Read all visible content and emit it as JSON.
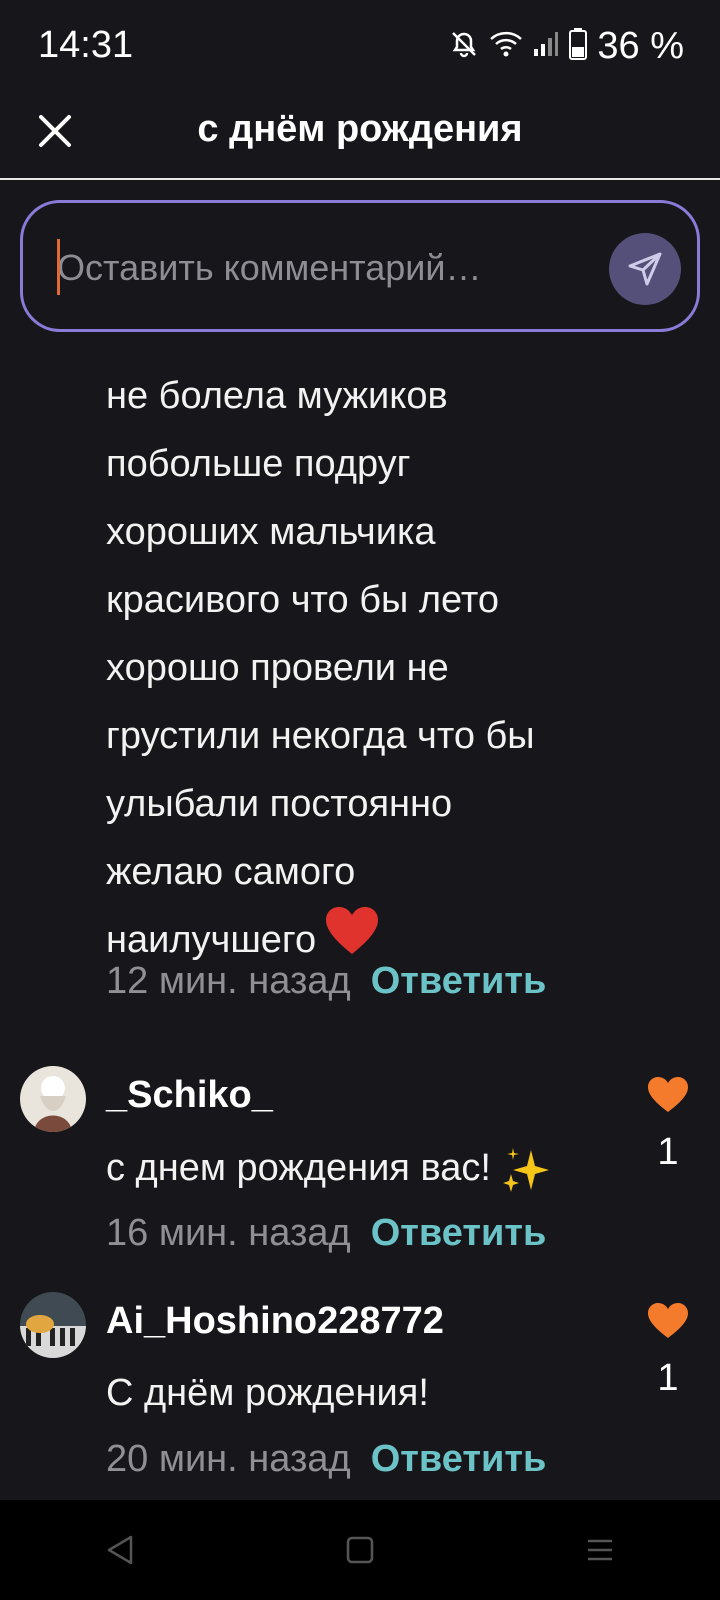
{
  "status": {
    "time": "14:31",
    "battery_text": "36 %",
    "icons": [
      "mute-icon",
      "wifi-icon",
      "signal-icon",
      "battery-icon"
    ]
  },
  "header": {
    "title": "с днём рождения",
    "close_icon": "close-icon"
  },
  "comment_box": {
    "placeholder": "Оставить комментарий…",
    "send_icon": "send-icon",
    "border_color": "#8a7bd8"
  },
  "continued_comment": {
    "lines": [
      "не болела мужиков",
      "побольше подруг",
      "хороших мальчика",
      "красивого что бы лето",
      "хорошо провели не",
      "грустили некогда что бы",
      "улыбали постоянно",
      "желаю самого",
      "наилучшего"
    ],
    "emoji": "heart-emoji",
    "time": "12 мин. назад",
    "reply": "Ответить"
  },
  "comments": [
    {
      "username": "_Schiko_",
      "text": "с днем рождения вас!",
      "emoji": "sparkles-emoji",
      "time": "16 мин. назад",
      "reply": "Ответить",
      "likes": "1"
    },
    {
      "username": "Ai_Hoshino228772",
      "text": "С днём рождения!",
      "time": "20 мин. назад",
      "reply": "Ответить",
      "likes": "1"
    }
  ],
  "colors": {
    "background": "#17161a",
    "reply": "#6cc3c7",
    "like_heart": "#f47a2c",
    "meta": "#8f8f94"
  },
  "nav": [
    "back-icon",
    "home-icon",
    "recents-icon"
  ]
}
